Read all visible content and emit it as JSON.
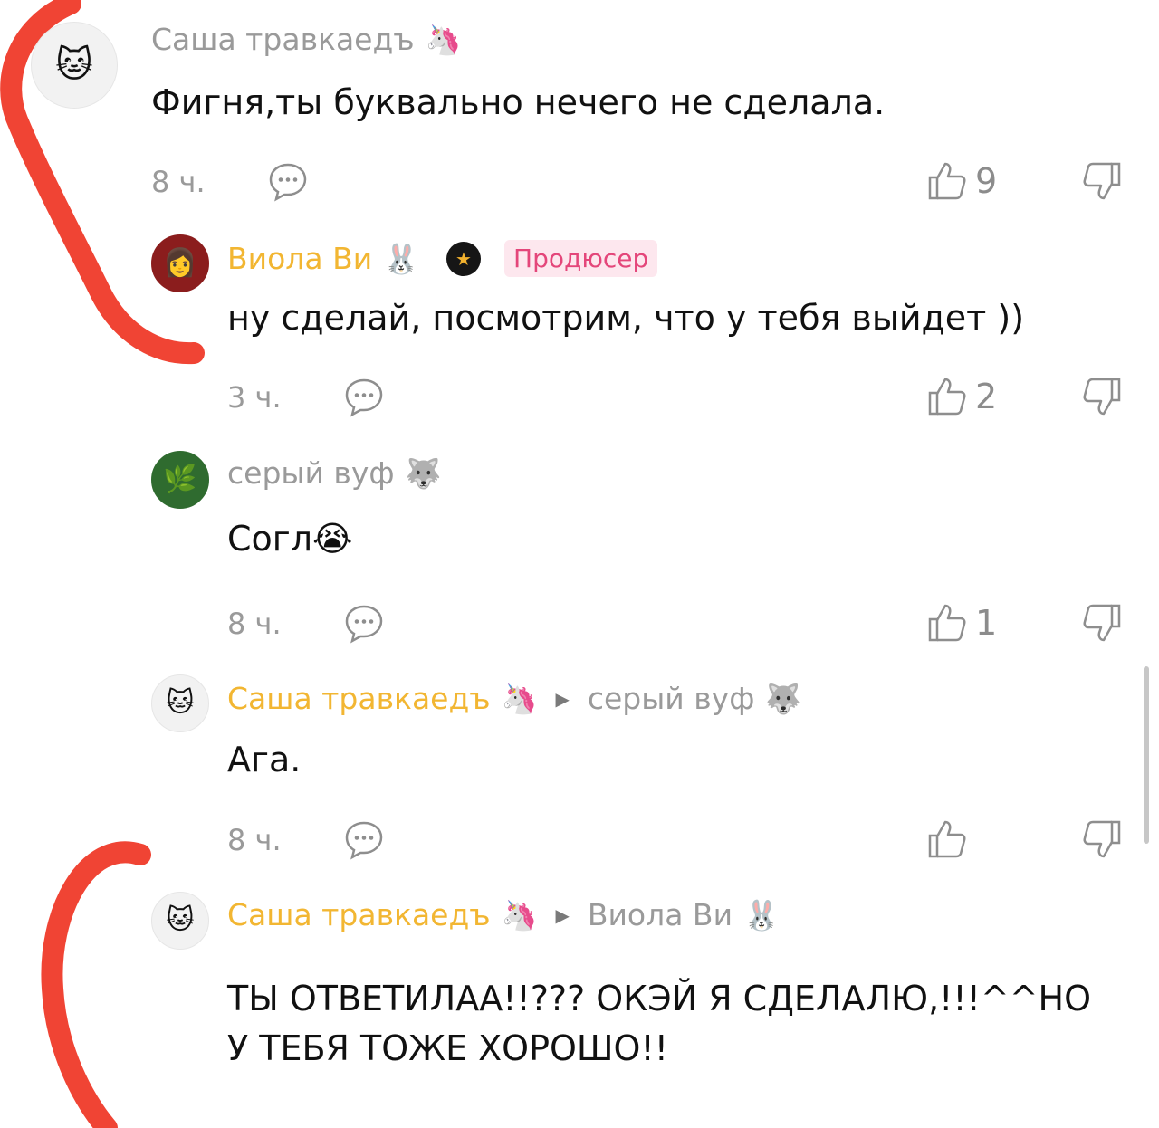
{
  "comments": [
    {
      "author": "Саша травкаедъ",
      "author_emoji": "🦄",
      "avatar_emoji": "🐱",
      "text": "Фигня,ты буквально нечего не сделала.",
      "time": "8 ч.",
      "likes": "9"
    },
    {
      "author": "Виола Ви",
      "author_emoji": "🐰",
      "badge": "Продюсер",
      "avatar_emoji": "👩",
      "text": "ну сделай, посмотрим, что у тебя выйдет ))",
      "time": "3 ч.",
      "likes": "2"
    },
    {
      "author": "серый вуф",
      "author_emoji": "🐺",
      "avatar_emoji": "🌿",
      "text": "Согл",
      "text_emoji": "😭",
      "time": "8 ч.",
      "likes": "1"
    },
    {
      "author": "Саша травкаедъ",
      "author_emoji": "🦄",
      "reply_to": "серый вуф",
      "reply_to_emoji": "🐺",
      "avatar_emoji": "🐱",
      "text": "Ага.",
      "time": "8 ч.",
      "likes": ""
    },
    {
      "author": "Саша травкаедъ",
      "author_emoji": "🦄",
      "reply_to": "Виола Ви",
      "reply_to_emoji": "🐰",
      "avatar_emoji": "🐱",
      "text_line1": "ТЫ ОТВЕТИЛАА!!??? ОКЭЙ Я СДЕЛАЛЮ,!!!^^НО",
      "text_line2": "У ТЕБЯ ТОЖЕ ХОРОШО!!"
    }
  ],
  "colors": {
    "accent_name": "#f2b632",
    "muted": "#9a9a9a",
    "badge_bg": "#fde7ee",
    "badge_text": "#e4467a",
    "annotation": "#f04434"
  }
}
